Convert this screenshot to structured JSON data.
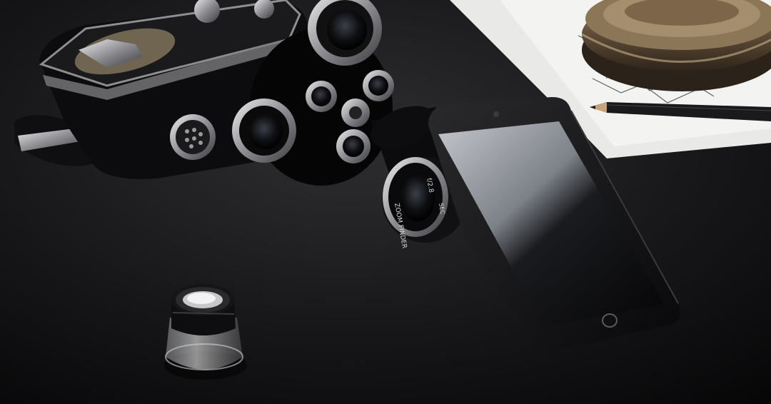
{
  "scene": {
    "description_type": "product photograph",
    "objects": [
      {
        "id": "movie-camera",
        "label": "vintage movie camera"
      },
      {
        "id": "smartphone",
        "label": "smartphone"
      },
      {
        "id": "loupe",
        "label": "magnifier loupe"
      },
      {
        "id": "film-canister",
        "label": "film reel canister"
      },
      {
        "id": "pencil",
        "label": "pencil"
      },
      {
        "id": "paper-sheets",
        "label": "paper sheets"
      }
    ],
    "lens_text": {
      "line1": "f/2.8",
      "line2": "ZOOM FINDER",
      "line3": "SEC"
    }
  },
  "colors": {
    "table": "#141416",
    "table_highlight": "#2a2a2d",
    "phone_body": "#0d0d0f",
    "phone_screen_light": "#b9bcc2",
    "phone_screen_dark": "#050507",
    "chrome": "#c9c9cc",
    "canister": "#6e5a42",
    "paper": "#eeeeec"
  }
}
